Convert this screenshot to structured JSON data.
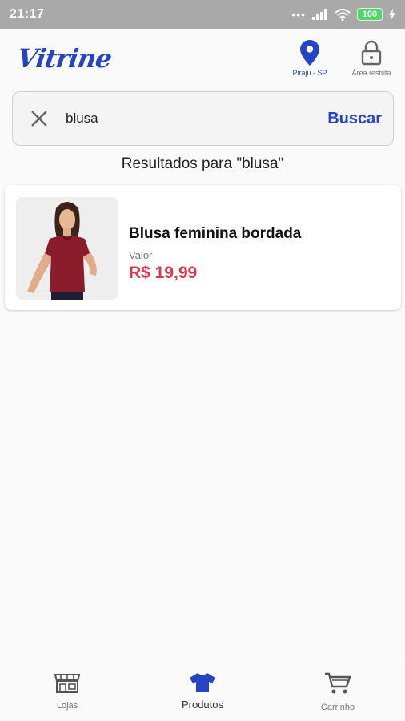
{
  "status": {
    "time": "21:17",
    "battery": "100",
    "icons": [
      "dots-icon",
      "signal-icon",
      "wifi-icon",
      "battery-icon",
      "charging-icon"
    ]
  },
  "header": {
    "logo": "Vitrine",
    "location_label": "Piraju - SP",
    "restricted_label": "Área restrita",
    "brand_color": "#2444c8"
  },
  "search": {
    "value": "blusa",
    "button_label": "Buscar"
  },
  "results": {
    "title": "Resultados para \"blusa\""
  },
  "products": [
    {
      "name": "Blusa feminina bordada",
      "price_label": "Valor",
      "price": "R$ 19,99",
      "price_color": "#e0344a"
    }
  ],
  "nav": {
    "tabs": [
      {
        "label": "Lojas",
        "icon": "store-icon",
        "active": false
      },
      {
        "label": "Produtos",
        "icon": "shirt-icon",
        "active": true
      },
      {
        "label": "Carrinho",
        "icon": "cart-icon",
        "active": false
      }
    ]
  }
}
